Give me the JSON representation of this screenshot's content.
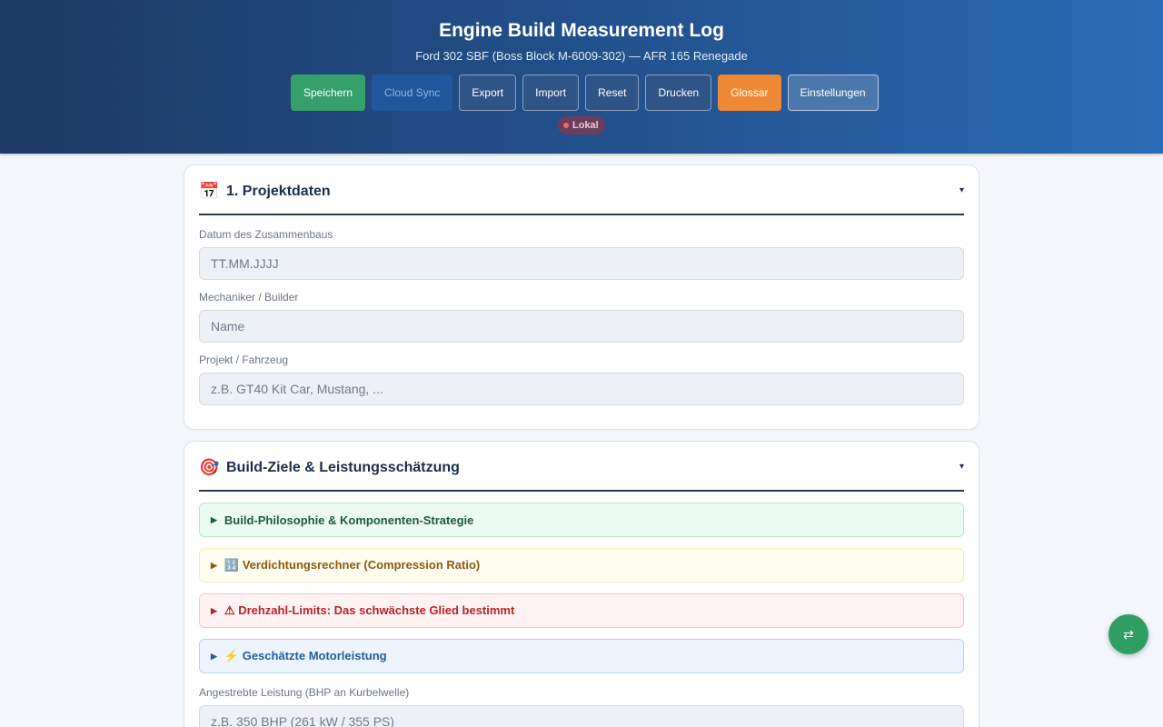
{
  "header": {
    "title": "Engine Build Measurement Log",
    "subtitle": "Ford 302 SBF (Boss Block M-6009-302) — AFR 165 Renegade",
    "toolbar": {
      "save": "Speichern",
      "cloud_sync": "Cloud Sync",
      "export": "Export",
      "import": "Import",
      "reset": "Reset",
      "print": "Drucken",
      "glossary": "Glossar",
      "settings": "Einstellungen"
    },
    "status": "Lokal"
  },
  "colors": {
    "header_from": "#1c3a64",
    "header_to": "#2a6cb5",
    "save_button": "#36a06a",
    "glossary_button": "#ee8a35",
    "status_dot": "#ef6a6a",
    "fab": "#2f9e63"
  },
  "project_section": {
    "icon": "calendar-icon",
    "icon_glyph": "📅",
    "title": "1. Projektdaten",
    "toggle": "▾",
    "fields": [
      {
        "label": "Datum des Zusammenbaus",
        "placeholder": "TT.MM.JJJJ",
        "value": ""
      },
      {
        "label": "Mechaniker / Builder",
        "placeholder": "Name",
        "value": ""
      },
      {
        "label": "Projekt / Fahrzeug",
        "placeholder": "z.B. GT40 Kit Car, Mustang, ...",
        "value": ""
      }
    ]
  },
  "goals_section": {
    "icon": "target-icon",
    "icon_glyph": "🎯",
    "title": "Build-Ziele & Leistungsschätzung",
    "toggle": "▾",
    "accordions": [
      {
        "arrow": "▶",
        "label": "Build-Philosophie & Komponenten-Strategie"
      },
      {
        "arrow": "▶",
        "label": "🔢 Verdichtungsrechner (Compression Ratio)"
      },
      {
        "arrow": "▶",
        "label": "⚠ Drehzahl-Limits: Das schwächste Glied bestimmt"
      },
      {
        "arrow": "▶",
        "label": "⚡ Geschätzte Motorleistung"
      }
    ],
    "target_power": {
      "label": "Angestrebte Leistung (BHP an Kurbelwelle)",
      "placeholder": "z.B. 350 BHP (261 kW / 355 PS)",
      "value": ""
    }
  },
  "fab": {
    "icon": "sync-arrows-icon",
    "glyph": "⇄"
  }
}
